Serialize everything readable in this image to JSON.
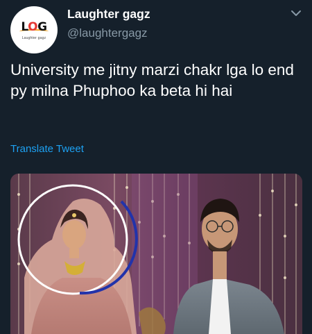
{
  "tweet": {
    "author_name": "Laughter gagz",
    "author_handle": "@laughtergagz",
    "avatar_logo": "LOG",
    "avatar_logo_sub": "Laughter gagz",
    "text": "University me jitny marzi chakr lga lo end py milna Phuphoo ka beta hi hai",
    "translate_label": "Translate Tweet",
    "menu_icon": "chevron-down-icon",
    "media_description_icon": "tweet-photo"
  },
  "colors": {
    "background": "#15202b",
    "primary_text": "#ffffff",
    "secondary_text": "#8899a6",
    "link": "#1da1f2",
    "highlight_circle_white": "#ffffff",
    "highlight_circle_blue": "#2233aa"
  }
}
